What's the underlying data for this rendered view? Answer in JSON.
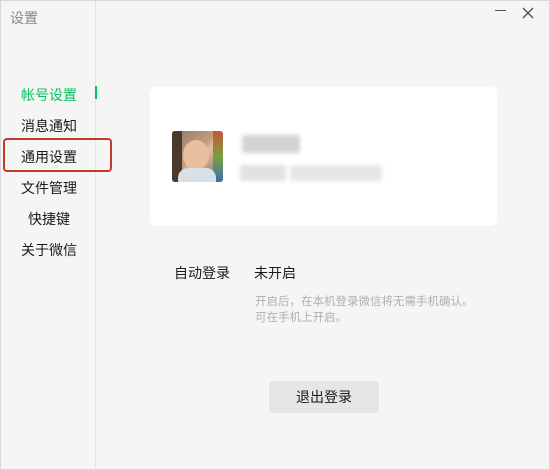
{
  "window": {
    "title": "设置"
  },
  "sidebar": {
    "items": [
      {
        "label": "帐号设置"
      },
      {
        "label": "消息通知"
      },
      {
        "label": "通用设置"
      },
      {
        "label": "文件管理"
      },
      {
        "label": "快捷键"
      },
      {
        "label": "关于微信"
      }
    ]
  },
  "account": {
    "auto_login_label": "自动登录",
    "auto_login_value": "未开启",
    "auto_login_desc_line1": "开启后，在本机登录微信将无需手机确认。",
    "auto_login_desc_line2": "可在手机上开启。",
    "logout_label": "退出登录"
  },
  "colors": {
    "accent": "#07c160",
    "highlight_box": "#c0392b",
    "background": "#f5f5f5"
  },
  "icons": {
    "minimize": "minimize-icon",
    "close": "close-icon"
  }
}
